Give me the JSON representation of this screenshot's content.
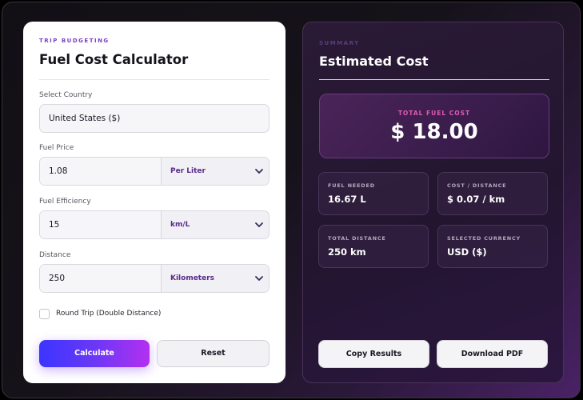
{
  "form": {
    "eyebrow": "TRIP BUDGETING",
    "title": "Fuel Cost Calculator",
    "country": {
      "label": "Select Country",
      "value": "United States ($)"
    },
    "fuel_price": {
      "label": "Fuel Price",
      "value": "1.08",
      "unit": "Per Liter"
    },
    "efficiency": {
      "label": "Fuel Efficiency",
      "value": "15",
      "unit": "km/L"
    },
    "distance": {
      "label": "Distance",
      "value": "250",
      "unit": "Kilometers"
    },
    "round_trip": {
      "label": "Round Trip (Double Distance)",
      "checked": false
    },
    "calculate_label": "Calculate",
    "reset_label": "Reset"
  },
  "summary": {
    "eyebrow": "SUMMARY",
    "title": "Estimated Cost",
    "total": {
      "label": "TOTAL FUEL COST",
      "value": "$ 18.00"
    },
    "stats": [
      {
        "label": "FUEL NEEDED",
        "value": "16.67 L"
      },
      {
        "label": "COST / DISTANCE",
        "value": "$ 0.07 / km"
      },
      {
        "label": "TOTAL DISTANCE",
        "value": "250 km"
      },
      {
        "label": "SELECTED CURRENCY",
        "value": "USD ($)"
      }
    ],
    "copy_label": "Copy Results",
    "download_label": "Download PDF"
  },
  "colors": {
    "accent_start": "#3b35ff",
    "accent_end": "#b330f0",
    "total_label": "#e05ab2",
    "panel_bg": "#231530"
  },
  "icons": [
    "chevron-down-icon",
    "checkbox-icon"
  ]
}
